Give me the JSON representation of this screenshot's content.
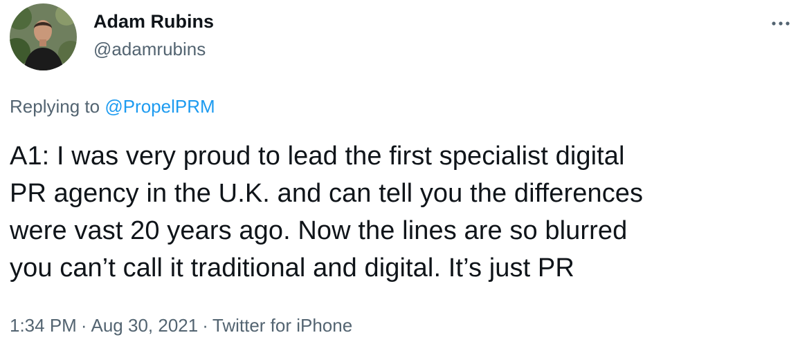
{
  "author": {
    "name": "Adam Rubins",
    "handle": "@adamrubins",
    "avatar_icon": "user-avatar-photo"
  },
  "menu": {
    "more_icon": "more-horizontal-icon"
  },
  "reply": {
    "prefix": "Replying to ",
    "mention": "@PropelPRM"
  },
  "tweet": {
    "lines": [
      "A1: I was very proud to lead the first specialist digital",
      "PR agency in the U.K. and can tell you the differences",
      "were vast 20 years ago. Now the lines are so blurred",
      "you can’t call it traditional and digital. It’s just PR"
    ]
  },
  "meta": {
    "time": "1:34 PM",
    "separator": "·",
    "date": "Aug 30, 2021",
    "source": "Twitter for iPhone"
  },
  "colors": {
    "text": "#0f1419",
    "secondary": "#536471",
    "link": "#1d9bf0"
  }
}
